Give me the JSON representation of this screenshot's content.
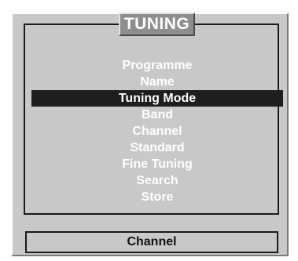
{
  "menu": {
    "title": "TUNING",
    "items": [
      {
        "label": "Programme",
        "selected": false
      },
      {
        "label": "Name",
        "selected": false
      },
      {
        "label": "Tuning Mode",
        "selected": true
      },
      {
        "label": "Band",
        "selected": false
      },
      {
        "label": "Channel",
        "selected": false
      },
      {
        "label": "Standard",
        "selected": false
      },
      {
        "label": "Fine Tuning",
        "selected": false
      },
      {
        "label": "Search",
        "selected": false
      },
      {
        "label": "Store",
        "selected": false
      }
    ]
  },
  "status": {
    "value": "Channel"
  },
  "colors": {
    "panel": "#c8c8c8",
    "title_tab": "#8e8e8e",
    "highlight": "#1e1e1e",
    "menu_text": "#ffffff"
  }
}
